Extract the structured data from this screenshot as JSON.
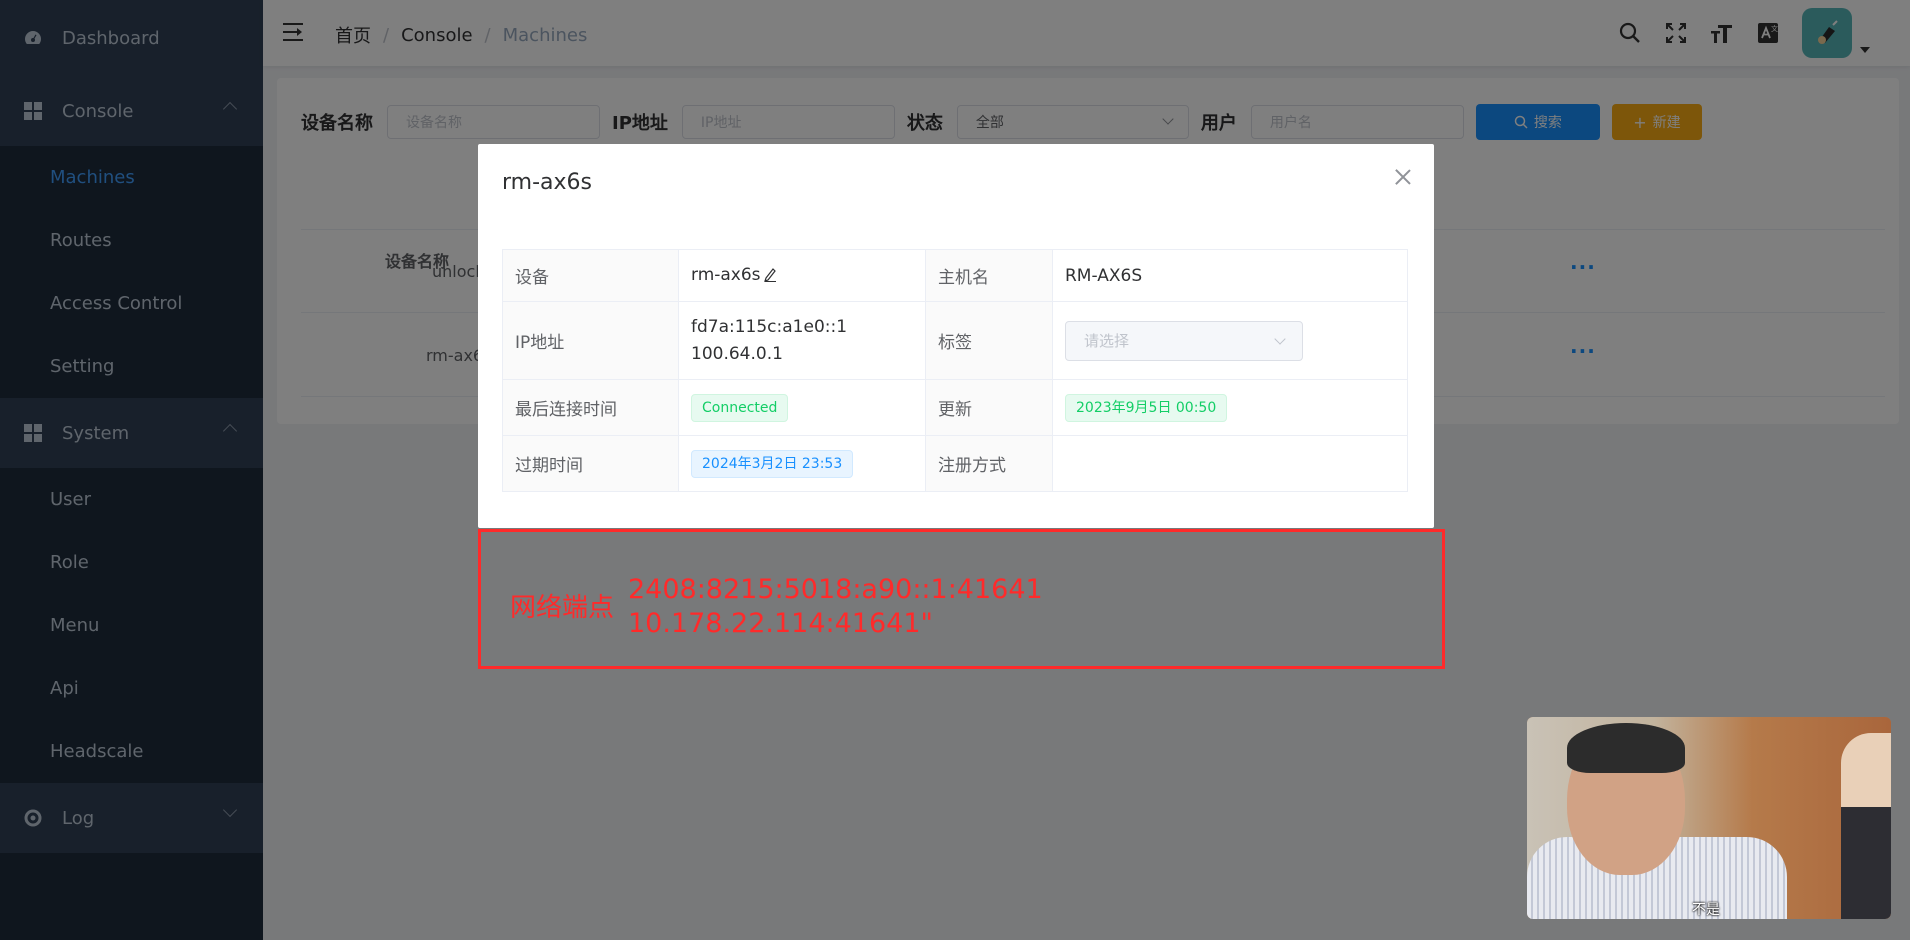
{
  "sidebar": {
    "dashboard": "Dashboard",
    "console": "Console",
    "console_items": [
      "Machines",
      "Routes",
      "Access Control",
      "Setting"
    ],
    "system": "System",
    "system_items": [
      "User",
      "Role",
      "Menu",
      "Api",
      "Headscale"
    ],
    "log": "Log"
  },
  "header": {
    "breadcrumb": [
      "首页",
      "Console",
      "Machines"
    ]
  },
  "filters": {
    "device_label": "设备名称",
    "device_placeholder": "设备名称",
    "ip_label": "IP地址",
    "ip_placeholder": "IP地址",
    "status_label": "状态",
    "status_value": "全部",
    "user_label": "用户",
    "user_placeholder": "用户名",
    "search_button": "搜索",
    "new_button": "新建"
  },
  "table": {
    "header_device": "设备名称",
    "rows": [
      {
        "device": "unlock"
      },
      {
        "device": "rm-ax6"
      }
    ],
    "more": "..."
  },
  "dialog": {
    "title": "rm-ax6s",
    "device_label": "设备",
    "device_value": "rm-ax6s",
    "hostname_label": "主机名",
    "hostname_value": "RM-AX6S",
    "ip_label": "IP地址",
    "ip_v6": "fd7a:115c:a1e0::1",
    "ip_v4": "100.64.0.1",
    "tags_label": "标签",
    "tags_placeholder": "请选择",
    "last_seen_label": "最后连接时间",
    "last_seen_value": "Connected",
    "updated_label": "更新",
    "updated_value": "2023年9月5日 00:50",
    "expiry_label": "过期时间",
    "expiry_value": "2024年3月2日 23:53",
    "register_label": "注册方式",
    "register_value": ""
  },
  "endpoint_box": {
    "label": "网络端点",
    "value_line1": "2408:8215:5018:a90::1:41641",
    "value_line2": "10.178.22.114:41641\""
  },
  "video": {
    "caption": "不是"
  },
  "colors": {
    "sidebar_bg": "#1f2d3d",
    "active_menu": "#409eff",
    "primary": "#1890ff",
    "warning": "#faad14",
    "annotation_red": "#ff2a2a"
  }
}
